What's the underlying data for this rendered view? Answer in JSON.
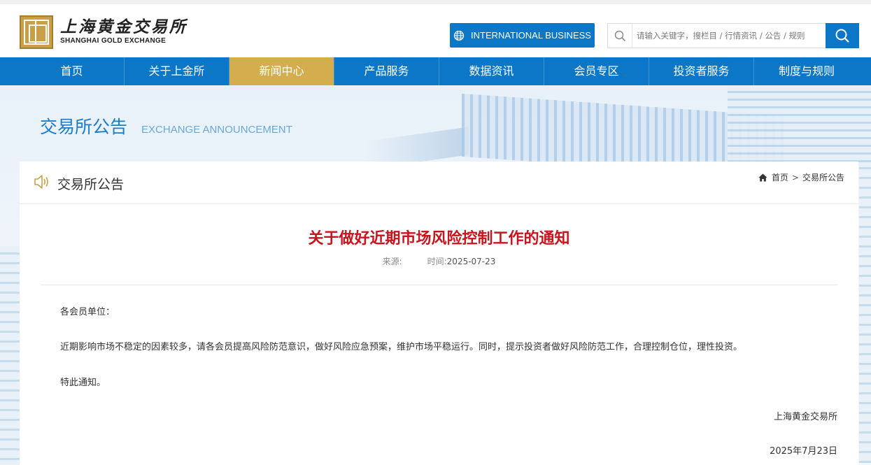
{
  "header": {
    "logo_cn": "上海黄金交易所",
    "logo_en": "SHANGHAI GOLD EXCHANGE",
    "intl_button": "INTERNATIONAL BUSINESS",
    "search_placeholder": "请输入关键字，搜栏目 / 行情资讯 / 公告 / 规则"
  },
  "nav": {
    "items": [
      {
        "label": "首页"
      },
      {
        "label": "关于上金所"
      },
      {
        "label": "新闻中心",
        "active": true
      },
      {
        "label": "产品服务"
      },
      {
        "label": "数据资讯"
      },
      {
        "label": "会员专区"
      },
      {
        "label": "投资者服务"
      },
      {
        "label": "制度与规则"
      }
    ]
  },
  "banner": {
    "title_cn": "交易所公告",
    "title_en": "EXCHANGE ANNOUNCEMENT"
  },
  "section": {
    "title": "交易所公告",
    "breadcrumb_home": "首页",
    "breadcrumb_sep": ">",
    "breadcrumb_current": "交易所公告"
  },
  "article": {
    "title": "关于做好近期市场风险控制工作的通知",
    "source_label": "来源:",
    "source_value": "",
    "time_label": "时间:",
    "time_value": "2025-07-23",
    "salutation": "各会员单位：",
    "paragraph": "近期影响市场不稳定的因素较多，请各会员提高风险防范意识，做好风险应急预案，维护市场平稳运行。同时，提示投资者做好风险防范工作，合理控制仓位，理性投资。",
    "closing": "特此通知。",
    "signature": "上海黄金交易所",
    "sign_date": "2025年7月23日"
  },
  "colors": {
    "brand_blue": "#0b77c6",
    "gold": "#d4ad4f",
    "title_red": "#c8141e"
  }
}
